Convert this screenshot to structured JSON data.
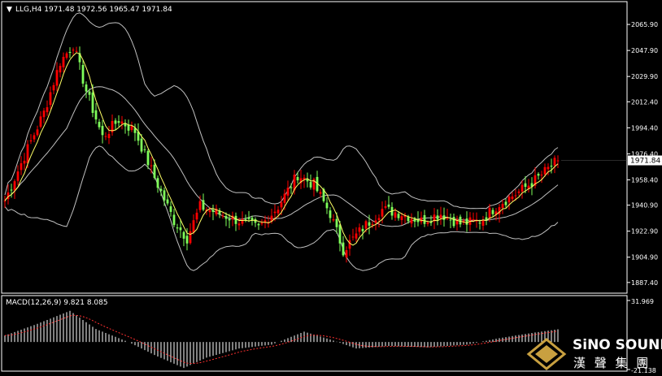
{
  "symbol_header": {
    "marker": "▼",
    "text": "LLG,H4  1971.48 1972.56 1965.47 1971.84"
  },
  "macd_header": {
    "text": "MACD(12,26,9) 9.821 8.085"
  },
  "current_price_label": "1971.84",
  "brand": {
    "name": "SiNO SOUND",
    "chinese": "漢 聲 集 團"
  },
  "colors": {
    "background": "#000000",
    "up_candle": "#ff0000",
    "down_candle": "#7fff5a",
    "ma": "#ffff66",
    "bands": "#c0c0c0",
    "axis": "#ffffff",
    "macd_hist": "#ffffff",
    "macd_signal": "#ff3030",
    "logo_gold": "#c8a040"
  },
  "chart_data": [
    {
      "type": "candlestick",
      "symbol": "LLG",
      "timeframe": "H4",
      "ohlc_last": {
        "open": 1971.48,
        "high": 1972.56,
        "low": 1965.47,
        "close": 1971.84
      },
      "ylim": [
        1880,
        2080
      ],
      "y_ticks": [
        2065.9,
        2047.9,
        2029.9,
        2012.4,
        1994.4,
        1976.4,
        1958.4,
        1940.9,
        1922.9,
        1904.9,
        1887.4
      ],
      "indicators": [
        "moving average",
        "bollinger bands"
      ],
      "close_path": [
        {
          "bar": 0,
          "price": 1944
        },
        {
          "bar": 6,
          "price": 1975
        },
        {
          "bar": 12,
          "price": 2005
        },
        {
          "bar": 17,
          "price": 2040
        },
        {
          "bar": 21,
          "price": 2052
        },
        {
          "bar": 25,
          "price": 2020
        },
        {
          "bar": 30,
          "price": 1988
        },
        {
          "bar": 35,
          "price": 2000
        },
        {
          "bar": 40,
          "price": 1992
        },
        {
          "bar": 46,
          "price": 1960
        },
        {
          "bar": 52,
          "price": 1930
        },
        {
          "bar": 56,
          "price": 1918
        },
        {
          "bar": 60,
          "price": 1940
        },
        {
          "bar": 66,
          "price": 1935
        },
        {
          "bar": 72,
          "price": 1930
        },
        {
          "bar": 78,
          "price": 1925
        },
        {
          "bar": 84,
          "price": 1940
        },
        {
          "bar": 90,
          "price": 1962
        },
        {
          "bar": 95,
          "price": 1955
        },
        {
          "bar": 100,
          "price": 1935
        },
        {
          "bar": 104,
          "price": 1910
        },
        {
          "bar": 110,
          "price": 1925
        },
        {
          "bar": 116,
          "price": 1938
        },
        {
          "bar": 122,
          "price": 1935
        },
        {
          "bar": 128,
          "price": 1930
        },
        {
          "bar": 134,
          "price": 1935
        },
        {
          "bar": 140,
          "price": 1928
        },
        {
          "bar": 146,
          "price": 1930
        },
        {
          "bar": 152,
          "price": 1942
        },
        {
          "bar": 158,
          "price": 1950
        },
        {
          "bar": 164,
          "price": 1960
        },
        {
          "bar": 170,
          "price": 1971.84
        }
      ]
    },
    {
      "type": "bar",
      "indicator": "MACD(12,26,9)",
      "macd": 9.821,
      "signal": 8.085,
      "ylim": [
        -21.138,
        31.969
      ],
      "y_ticks": [
        31.969,
        -21.138
      ],
      "histogram_path": [
        {
          "bar": 0,
          "value": 5
        },
        {
          "bar": 10,
          "value": 14
        },
        {
          "bar": 20,
          "value": 24
        },
        {
          "bar": 28,
          "value": 10
        },
        {
          "bar": 38,
          "value": 0
        },
        {
          "bar": 46,
          "value": -10
        },
        {
          "bar": 55,
          "value": -20
        },
        {
          "bar": 62,
          "value": -12
        },
        {
          "bar": 72,
          "value": -5
        },
        {
          "bar": 82,
          "value": -2
        },
        {
          "bar": 92,
          "value": 8
        },
        {
          "bar": 100,
          "value": 2
        },
        {
          "bar": 108,
          "value": -5
        },
        {
          "bar": 118,
          "value": -3
        },
        {
          "bar": 130,
          "value": -4
        },
        {
          "bar": 142,
          "value": -2
        },
        {
          "bar": 152,
          "value": 3
        },
        {
          "bar": 162,
          "value": 7
        },
        {
          "bar": 170,
          "value": 9.821
        }
      ]
    }
  ]
}
